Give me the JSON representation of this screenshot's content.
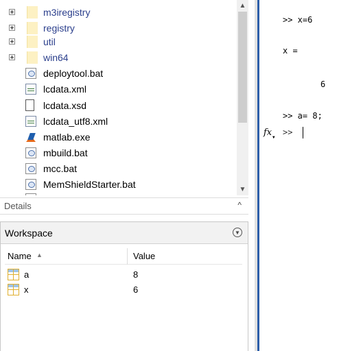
{
  "file_browser": {
    "folders": [
      {
        "label": "m3iregistry"
      },
      {
        "label": "registry"
      },
      {
        "label": "util"
      },
      {
        "label": "win64"
      }
    ],
    "files": [
      {
        "label": "deploytool.bat",
        "icon": "bat-file-icon"
      },
      {
        "label": "lcdata.xml",
        "icon": "xml-file-icon"
      },
      {
        "label": "lcdata.xsd",
        "icon": "blank-file-icon"
      },
      {
        "label": "lcdata_utf8.xml",
        "icon": "xml-file-icon"
      },
      {
        "label": "matlab.exe",
        "icon": "matlab-logo-icon"
      },
      {
        "label": "mbuild.bat",
        "icon": "bat-file-icon"
      },
      {
        "label": "mcc.bat",
        "icon": "bat-file-icon"
      },
      {
        "label": "MemShieldStarter.bat",
        "icon": "bat-file-icon"
      }
    ]
  },
  "details": {
    "title": "Details",
    "toggle": "^"
  },
  "workspace": {
    "title": "Workspace",
    "columns": {
      "name": "Name",
      "value": "Value"
    },
    "sort_indicator": "▲",
    "variables": [
      {
        "name": "a",
        "value": "8"
      },
      {
        "name": "x",
        "value": "6"
      }
    ]
  },
  "command_window": {
    "lines": [
      ">> x=6",
      "x =",
      "6",
      ">> a= 8;"
    ],
    "prompt": ">>",
    "fx_label": "fx"
  },
  "colors": {
    "splitter_accent": "#2e5faa",
    "folder_label": "#2b3f8c",
    "scrollbar_thumb": "#cdcdcd"
  }
}
